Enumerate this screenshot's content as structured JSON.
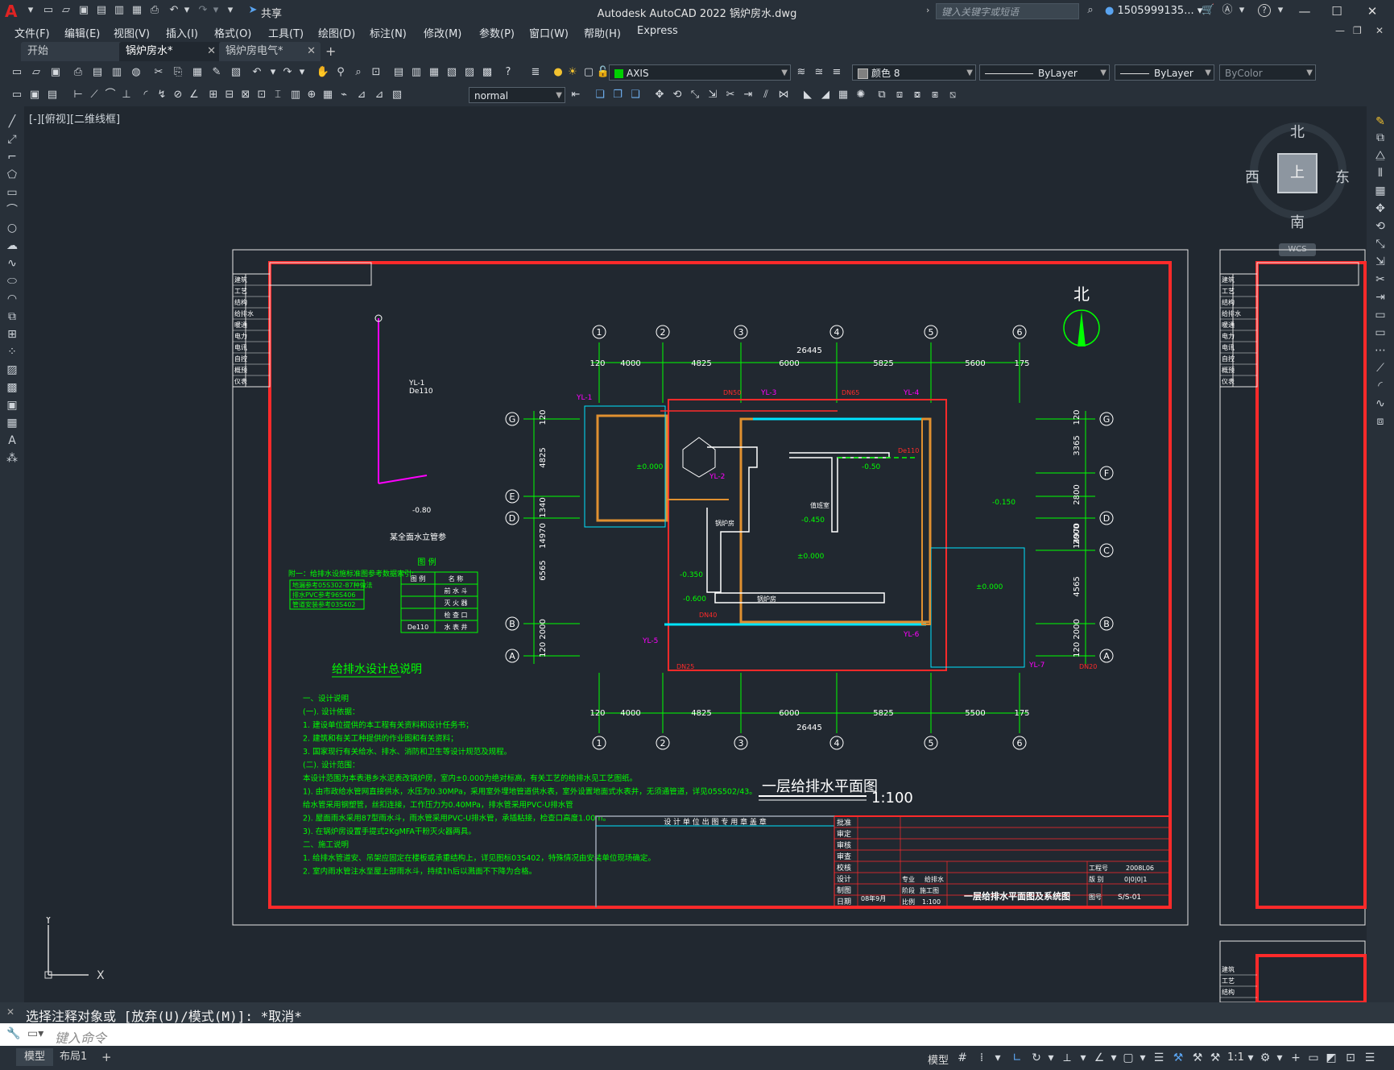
{
  "titlebar": {
    "app_icon": "A",
    "title": "Autodesk AutoCAD 2022    锅炉房水.dwg",
    "share_label": "共享",
    "search_placeholder": "键入关键字或短语",
    "user": "1505999135...",
    "help_icon": "?"
  },
  "menu": [
    "文件(F)",
    "编辑(E)",
    "视图(V)",
    "插入(I)",
    "格式(O)",
    "工具(T)",
    "绘图(D)",
    "标注(N)",
    "修改(M)",
    "参数(P)",
    "窗口(W)",
    "帮助(H)",
    "Express"
  ],
  "tabs": [
    {
      "label": "开始"
    },
    {
      "label": "锅炉房水*"
    },
    {
      "label": "锅炉房电气*"
    }
  ],
  "toolbar": {
    "layer": "AXIS",
    "color": "颜色 8",
    "linetype": "ByLayer",
    "lineweight": "ByLayer",
    "plotstyle": "ByColor",
    "textstyle": "normal"
  },
  "viewport_label": "[-][俯视][二维线框]",
  "compass": {
    "north": "北",
    "south": "南",
    "east": "东",
    "west": "西",
    "center": "上",
    "wcs": "WCS"
  },
  "ucs": {
    "x": "X",
    "y": "Y"
  },
  "drawing": {
    "north_arrow": "北",
    "axis_numbers": [
      "1",
      "2",
      "3",
      "4",
      "5",
      "6"
    ],
    "axis_letters_left": [
      "G",
      "E",
      "D",
      "B",
      "A"
    ],
    "axis_letters_right": [
      "G",
      "F",
      "D",
      "C",
      "B",
      "A"
    ],
    "dim_total": "26445",
    "dims_top": [
      "120",
      "4000",
      "4825",
      "6000",
      "5825",
      "5600",
      "175"
    ],
    "dims_bottom": [
      "120",
      "4000",
      "4825",
      "6000",
      "5825",
      "5500",
      "175"
    ],
    "dims_left": [
      "120",
      "4825",
      "1340",
      "14970",
      "6565",
      "120 2000"
    ],
    "dims_right": [
      "120",
      "3365",
      "2800",
      "2000",
      "14970",
      "4565",
      "120 2000"
    ],
    "elevations": [
      "±0.000",
      "±0.000",
      "±0.000",
      "-0.450",
      "-0.50",
      "-0.150",
      "-0.600",
      "-0.350"
    ],
    "riser_labels": [
      "YL-1",
      "YL-2",
      "YL-3",
      "YL-4",
      "YL-5",
      "YL-6",
      "YL-7"
    ],
    "pipe_sizes": [
      "DN50",
      "DN65",
      "DN40",
      "DN25",
      "DN20",
      "De110"
    ],
    "riser_detail_label": "YL-1",
    "riser_detail_size": "De110",
    "riser_detail_elev": "-0.80",
    "riser_detail_caption": "某全面水立管参",
    "title_plan": "一层给排水平面图",
    "scale": "1:100",
    "legend_title": "图  例",
    "legend_rows": [
      [
        "图 例",
        "名 称"
      ],
      [
        "",
        "前 水 斗"
      ],
      [
        "",
        "灭 火 器"
      ],
      [
        "",
        "检 查 口"
      ],
      [
        "De110",
        "水 表 井"
      ]
    ],
    "std_title": "附一：给排水设施标准图参考数据索引:",
    "std_rows": [
      "地漏参考05S302-87种做法",
      "排水PVC参考96S406",
      "管道安装参考03S402"
    ],
    "notes_title": "给排水设计总说明",
    "notes": [
      "一、设计说明",
      "(一). 设计依据：",
      "  1. 建设单位提供的本工程有关资料和设计任务书；",
      "  2. 建筑和有关工种提供的作业图和有关资料；",
      "  3. 国家现行有关给水、排水、消防和卫生等设计规范及规程。",
      "(二). 设计范围：",
      "  本设计范围为本表港乡水泥表改锅炉房，室内±0.000为绝对标高，有关工艺的给排水见工艺图纸。",
      "1). 由市政给水管网直接供水，水压为0.30MPa，采用室外埋地管道供水表，室外设置地面式水表井，无须通管道，详见05S502/43。",
      "   给水管采用钢塑管，丝扣连接，工作压力为0.40MPa，排水管采用PVC-U排水管",
      "2). 屋面雨水采用87型雨水斗，雨水管采用PVC-U排水管，承插粘接，检查口高度1.00m。",
      "3). 在锅炉房设置手提式2KgMFA干粉灭火器两具。",
      "二、施工说明",
      "  1. 给排水管道安、吊架应固定在楼板或承重结构上，详见图标03S402，特殊情况由安装单位现场确定。",
      "  2. 室内雨水管注水至屋上部雨水斗，持续1h后以溅面不下降为合格。"
    ],
    "room_labels": [
      "锅炉房",
      "值班室",
      "锅炉房"
    ],
    "tb_header": "设 计 单 位 出 图 专 用 章 盖 章",
    "tb_left": [
      "批准",
      "审定",
      "审核",
      "审查",
      "校核",
      "设计",
      "制图",
      "日期"
    ],
    "tb_date": "08年9月",
    "tb_major_label": "专业",
    "tb_major": "给排水",
    "tb_stage_label": "阶段",
    "tb_stage": "施工图",
    "tb_scale_label": "比例",
    "tb_scale": "1:100",
    "tb_project_no_label": "工程号",
    "tb_project_no": "2008L06",
    "tb_version_label": "版  别",
    "tb_version": "0|0|0|1",
    "tb_sheet_label": "图号",
    "tb_sheet": "S/S-01",
    "tb_drawing_title": "一层给排水平面图及系统图",
    "side_labels": [
      "建筑",
      "工艺",
      "结构",
      "给排水",
      "暖通",
      "电力",
      "电讯",
      "自控",
      "概预",
      "仪表"
    ]
  },
  "command": {
    "history": "选择注释对象或 [放弃(U)/模式(M)]: *取消*",
    "placeholder": "键入命令"
  },
  "status": {
    "layout_tabs": [
      "模型",
      "布局1"
    ],
    "model_label": "模型",
    "anno_scale": "1:1"
  }
}
